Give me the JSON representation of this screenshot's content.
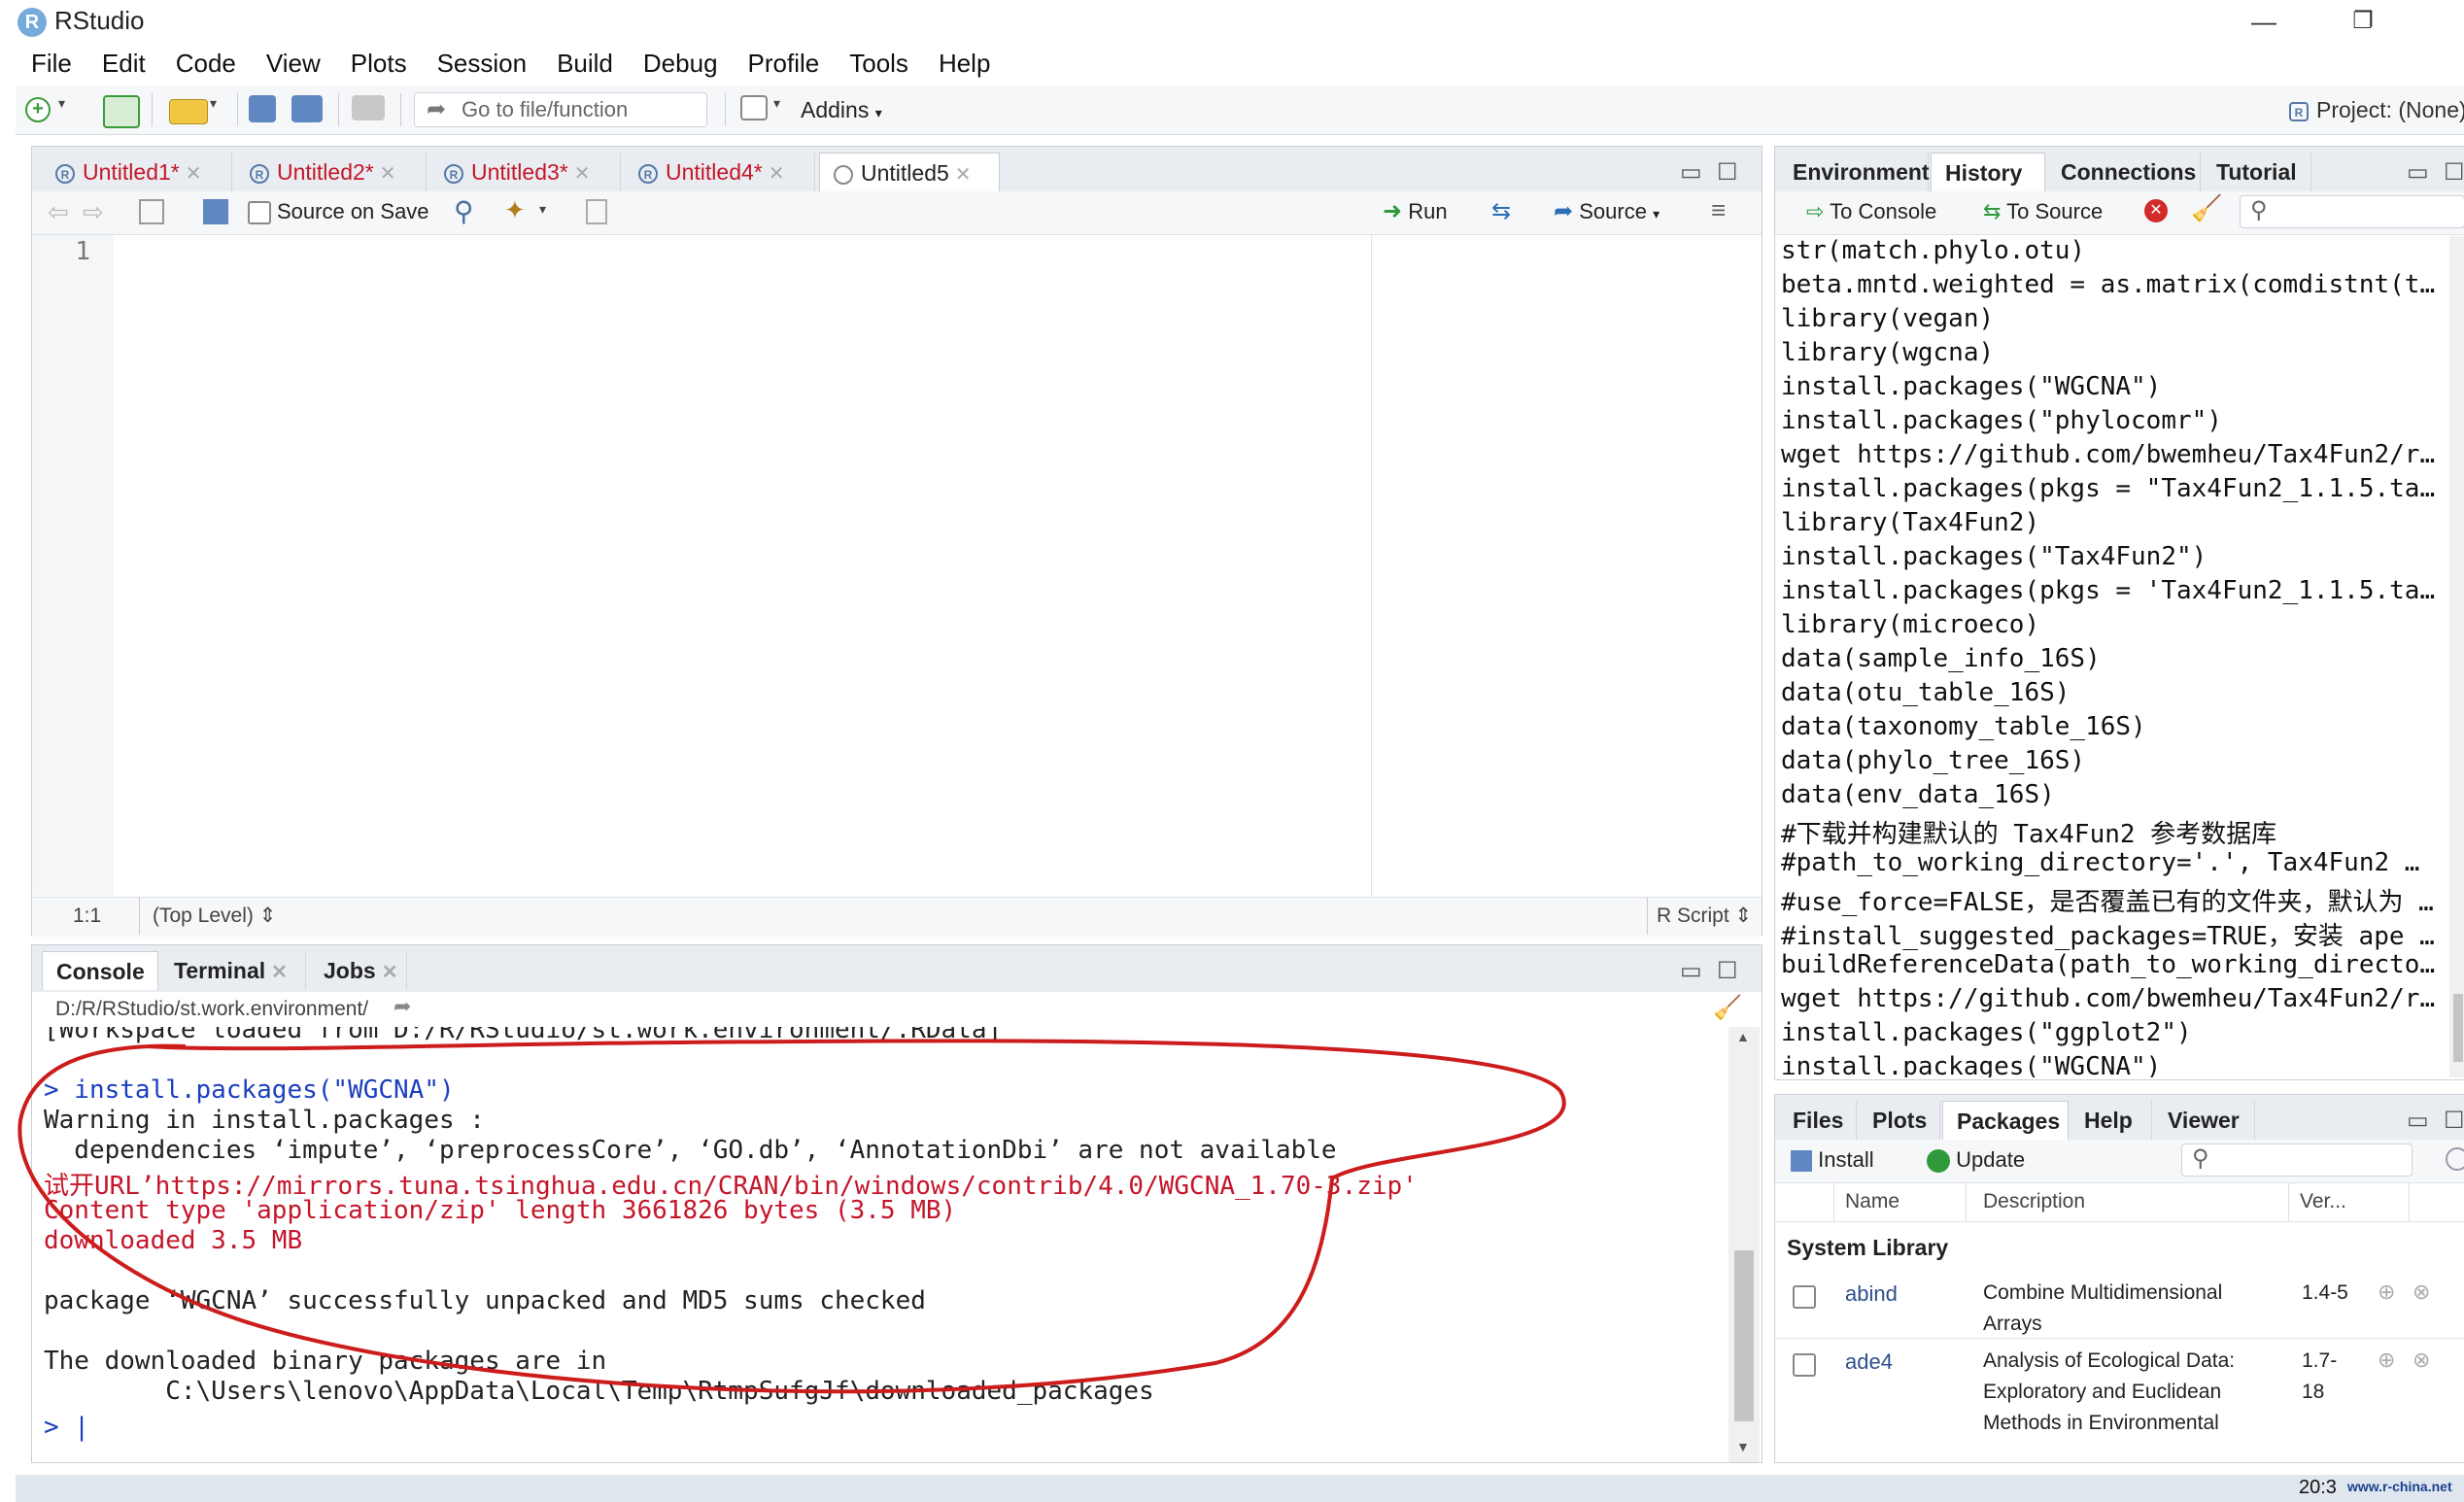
{
  "window": {
    "title": "RStudio",
    "logo": "R"
  },
  "menu": [
    "File",
    "Edit",
    "Code",
    "View",
    "Plots",
    "Session",
    "Build",
    "Debug",
    "Profile",
    "Tools",
    "Help"
  ],
  "toolbar": {
    "goto_placeholder": "Go to file/function",
    "addins_label": "Addins",
    "project_label": "Project: (None)"
  },
  "editor": {
    "tabs": [
      {
        "label": "Untitled1*",
        "modified": true
      },
      {
        "label": "Untitled2*",
        "modified": true
      },
      {
        "label": "Untitled3*",
        "modified": true
      },
      {
        "label": "Untitled4*",
        "modified": true
      },
      {
        "label": "Untitled5",
        "modified": false
      }
    ],
    "source_on_save": "Source on Save",
    "run_label": "Run",
    "source_label": "Source",
    "line_number": "1",
    "cursor_pos": "1:1",
    "scope": "(Top Level)",
    "file_type": "R Script"
  },
  "console": {
    "tabs": [
      "Console",
      "Terminal",
      "Jobs"
    ],
    "path": "D:/R/RStudio/st.work.environment/",
    "lines": [
      {
        "text": "[Workspace loaded from D:/R/RStudio/st.work.environment/.RData]",
        "color": "#222222"
      },
      {
        "text": "",
        "color": "#222222"
      },
      {
        "text": "> install.packages(\"WGCNA\")",
        "color": "#1c3fbf"
      },
      {
        "text": "Warning in install.packages :",
        "color": "#222222"
      },
      {
        "text": "  dependencies ‘impute’, ‘preprocessCore’, ‘GO.db’, ‘AnnotationDbi’ are not available",
        "color": "#222222"
      },
      {
        "text": "试开URL’https://mirrors.tuna.tsinghua.edu.cn/CRAN/bin/windows/contrib/4.0/WGCNA_1.70-3.zip'",
        "color": "#c4162a"
      },
      {
        "text": "Content type 'application/zip' length 3661826 bytes (3.5 MB)",
        "color": "#c4162a"
      },
      {
        "text": "downloaded 3.5 MB",
        "color": "#c4162a"
      },
      {
        "text": "",
        "color": "#222222"
      },
      {
        "text": "package ‘WGCNA’ successfully unpacked and MD5 sums checked",
        "color": "#222222"
      },
      {
        "text": "",
        "color": "#222222"
      },
      {
        "text": "The downloaded binary packages are in",
        "color": "#222222"
      },
      {
        "text": "        C:\\Users\\lenovo\\AppData\\Local\\Temp\\RtmpSufgJf\\downloaded_packages",
        "color": "#222222"
      }
    ],
    "prompt": ">"
  },
  "history_pane": {
    "tabs": [
      "Environment",
      "History",
      "Connections",
      "Tutorial"
    ],
    "active_tab": "History",
    "to_console": "To Console",
    "to_source": "To Source",
    "lines": [
      "str(match.phylo.otu)",
      "beta.mntd.weighted = as.matrix(comdistnt(t…",
      "library(vegan)",
      "library(wgcna)",
      "install.packages(\"WGCNA\")",
      "install.packages(\"phylocomr\")",
      "wget https://github.com/bwemheu/Tax4Fun2/r…",
      "install.packages(pkgs = \"Tax4Fun2_1.1.5.ta…",
      "library(Tax4Fun2)",
      "install.packages(\"Tax4Fun2\")",
      "install.packages(pkgs = 'Tax4Fun2_1.1.5.ta…",
      "library(microeco)",
      "data(sample_info_16S)",
      "data(otu_table_16S)",
      "data(taxonomy_table_16S)",
      "data(phylo_tree_16S)",
      "data(env_data_16S)",
      "#下载并构建默认的 Tax4Fun2 参考数据库",
      "#path_to_working_directory='.', Tax4Fun2 …",
      "#use_force=FALSE，是否覆盖已有的文件夹，默认为 …",
      "#install_suggested_packages=TRUE，安装 ape …",
      "buildReferenceData(path_to_working_directo…",
      "wget https://github.com/bwemheu/Tax4Fun2/r…",
      "install.packages(\"ggplot2\")",
      "install.packages(\"WGCNA\")"
    ]
  },
  "packages_pane": {
    "tabs": [
      "Files",
      "Plots",
      "Packages",
      "Help",
      "Viewer"
    ],
    "active_tab": "Packages",
    "install_label": "Install",
    "update_label": "Update",
    "columns": [
      "Name",
      "Description",
      "Ver..."
    ],
    "section": "System Library",
    "rows": [
      {
        "name": "abind",
        "desc1": "Combine Multidimensional",
        "desc2": "Arrays",
        "ver1": "1.4-5",
        "ver2": ""
      },
      {
        "name": "ade4",
        "desc1": "Analysis of Ecological Data:",
        "desc2": "Exploratory and Euclidean",
        "desc3": "Methods in Environmental",
        "ver1": "1.7-",
        "ver2": "18"
      }
    ]
  },
  "watermark": "www.r-china.net",
  "clock": "20:3"
}
